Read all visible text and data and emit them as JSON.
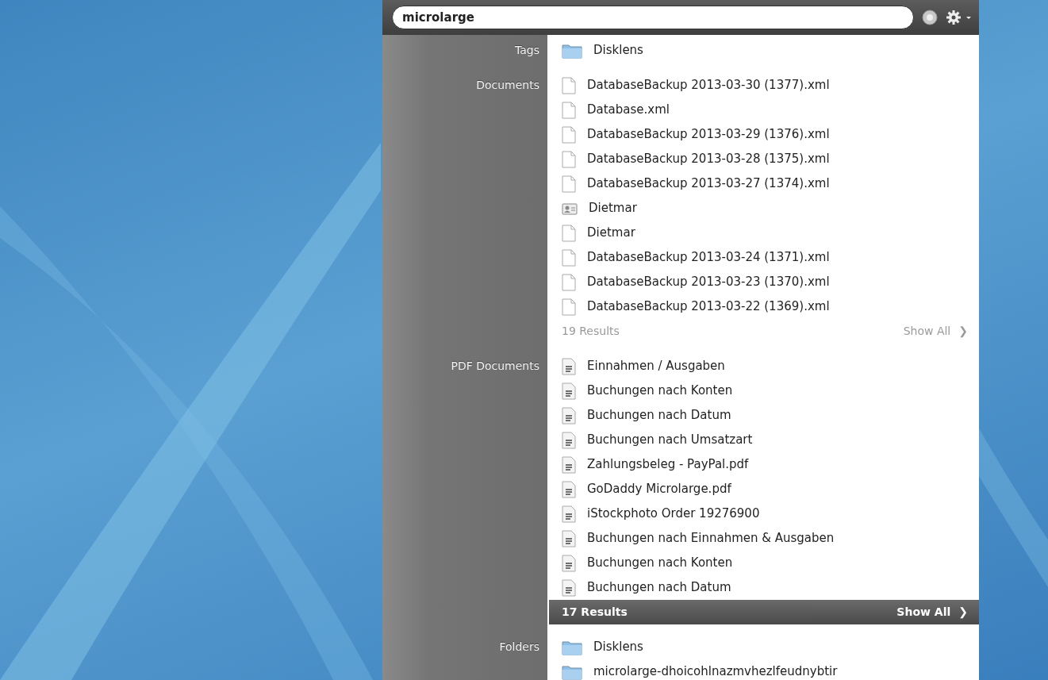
{
  "search": {
    "value": "microlarge"
  },
  "sections": [
    {
      "label": "Tags",
      "items": [
        {
          "kind": "folder",
          "text": "Disklens"
        }
      ]
    },
    {
      "label": "Documents",
      "items": [
        {
          "kind": "document",
          "text": "DatabaseBackup 2013-03-30 (1377).xml"
        },
        {
          "kind": "document",
          "text": "Database.xml"
        },
        {
          "kind": "document",
          "text": "DatabaseBackup 2013-03-29 (1376).xml"
        },
        {
          "kind": "document",
          "text": "DatabaseBackup 2013-03-28 (1375).xml"
        },
        {
          "kind": "document",
          "text": "DatabaseBackup 2013-03-27 (1374).xml"
        },
        {
          "kind": "contact",
          "text": "Dietmar"
        },
        {
          "kind": "document",
          "text": "Dietmar"
        },
        {
          "kind": "document",
          "text": "DatabaseBackup 2013-03-24 (1371).xml"
        },
        {
          "kind": "document",
          "text": "DatabaseBackup 2013-03-23 (1370).xml"
        },
        {
          "kind": "document",
          "text": "DatabaseBackup 2013-03-22 (1369).xml"
        }
      ],
      "footer": {
        "count": "19 Results",
        "show_all": "Show All",
        "arrow": "❯",
        "selected": false
      }
    },
    {
      "label": "PDF Documents",
      "items": [
        {
          "kind": "pdf",
          "text": "Einnahmen / Ausgaben"
        },
        {
          "kind": "pdf",
          "text": "Buchungen nach Konten"
        },
        {
          "kind": "pdf",
          "text": "Buchungen nach Datum"
        },
        {
          "kind": "pdf",
          "text": "Buchungen nach Umsatzart"
        },
        {
          "kind": "pdf",
          "text": "Zahlungsbeleg - PayPal.pdf"
        },
        {
          "kind": "pdf",
          "text": "GoDaddy Microlarge.pdf"
        },
        {
          "kind": "pdf",
          "text": "iStockphoto Order 19276900"
        },
        {
          "kind": "pdf",
          "text": "Buchungen nach Einnahmen & Ausgaben"
        },
        {
          "kind": "pdf",
          "text": "Buchungen nach Konten"
        },
        {
          "kind": "pdf",
          "text": "Buchungen nach Datum"
        }
      ],
      "footer": {
        "count": "17 Results",
        "show_all": "Show All",
        "arrow": "❯",
        "selected": true
      }
    },
    {
      "label": "Folders",
      "items": [
        {
          "kind": "folder",
          "text": "Disklens"
        },
        {
          "kind": "folder",
          "text": "microlarge-dhoicohlnazmvhezlfeudnybtir"
        }
      ]
    }
  ]
}
